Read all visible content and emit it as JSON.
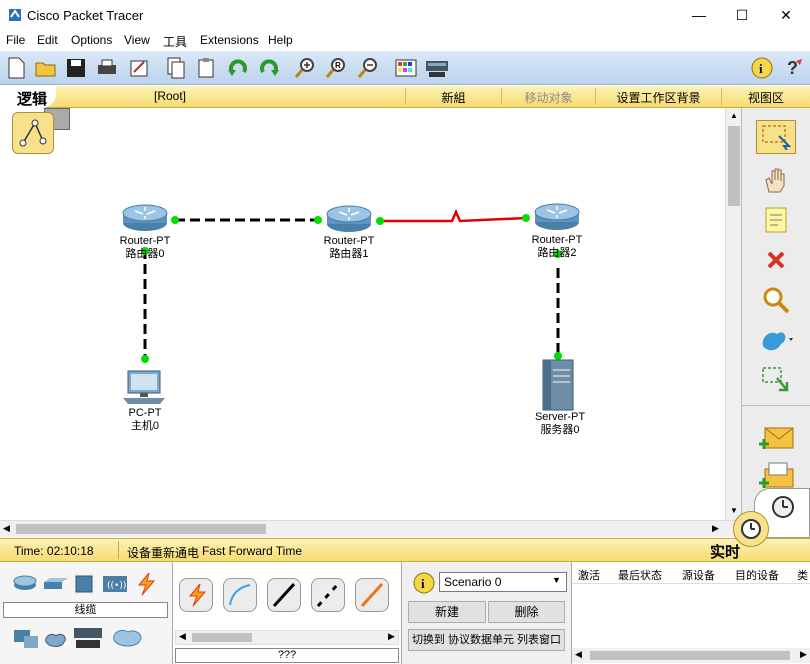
{
  "window": {
    "title": "Cisco Packet Tracer",
    "minimize": "—",
    "maximize": "☐",
    "close": "✕"
  },
  "menu": [
    "File",
    "Edit",
    "Options",
    "View",
    "工具",
    "Extensions",
    "Help"
  ],
  "logicbar": {
    "tab": "逻辑",
    "root": "[Root]",
    "new_cluster": "新組",
    "move_object": "移动对象",
    "set_background": "设置工作区背景",
    "viewport": "视图区"
  },
  "devices": [
    {
      "model": "Router-PT",
      "name": "路由器0"
    },
    {
      "model": "Router-PT",
      "name": "路由器1"
    },
    {
      "model": "Router-PT",
      "name": "路由器2"
    },
    {
      "model": "PC-PT",
      "name": "主机0"
    },
    {
      "model": "Server-PT",
      "name": "服务器0"
    }
  ],
  "status": {
    "time": "Time: 02:10:18",
    "power_cycle": "设备重新通电",
    "fast_forward": "Fast Forward Time",
    "realtime": "实时"
  },
  "device_panel": {
    "category": "线缆",
    "bottom_label": "???"
  },
  "scenario": {
    "selected": "Scenario 0",
    "new_button": "新建",
    "delete_button": "删除",
    "toggle_button": "切换到 协议数据单元 列表窗口"
  },
  "pdu_table": {
    "columns": [
      "激活",
      "最后状态",
      "源设备",
      "目的设备",
      "类"
    ]
  },
  "colors": {
    "link_green": "#00dd00",
    "serial_red": "#e00000",
    "toolbar_blue": "#bcd2ec",
    "bar_yellow": "#f5dc70"
  },
  "icons": {
    "toolbar": [
      "new-file-icon",
      "open-folder-icon",
      "save-icon",
      "print-icon",
      "activity-wizard-icon",
      "copy-icon",
      "paste-icon",
      "undo-icon",
      "redo-icon",
      "zoom-in-icon",
      "zoom-reset-icon",
      "zoom-out-icon",
      "palette-icon",
      "custom-device-icon",
      "info-icon",
      "help-icon"
    ],
    "right": [
      "select-icon",
      "move-hand-icon",
      "note-icon",
      "delete-icon",
      "inspect-icon",
      "draw-shape-icon",
      "resize-icon",
      "add-simple-pdu-icon",
      "add-complex-pdu-icon"
    ]
  }
}
